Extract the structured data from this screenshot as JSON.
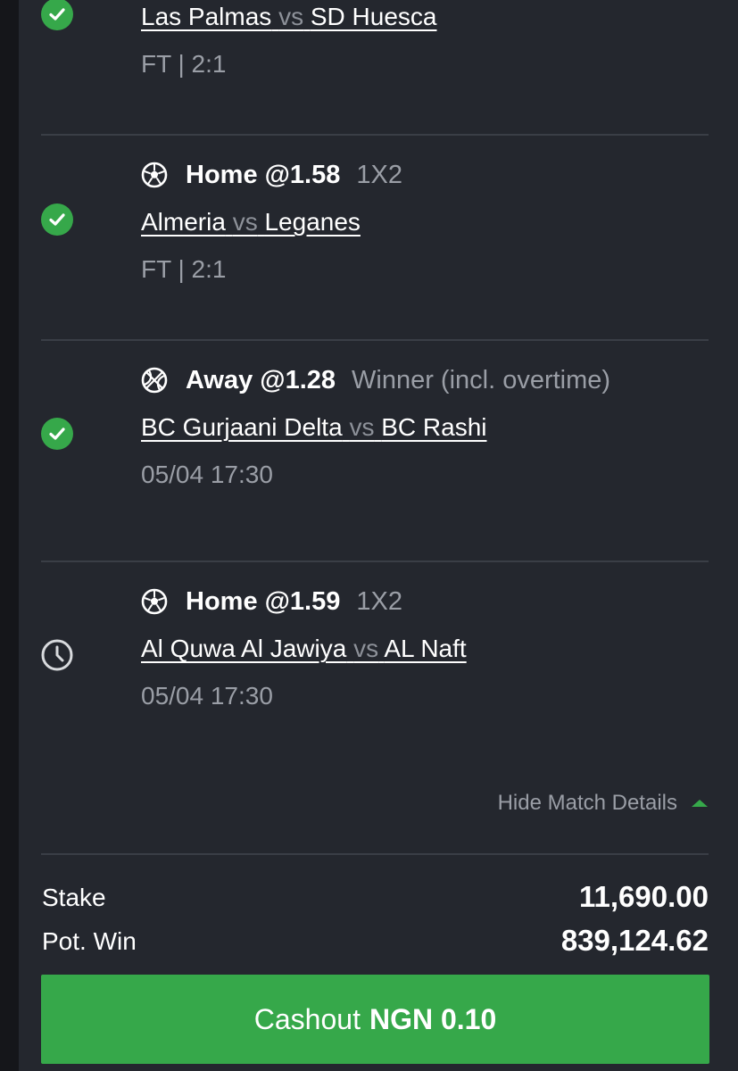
{
  "colors": {
    "page_bg": "#15161a",
    "panel_bg": "#24272e",
    "accent_green": "#36a84a",
    "muted_text": "#9a9ea6",
    "divider": "#3a3e46"
  },
  "selections": [
    {
      "status": "won",
      "status_icon": "check-circle-icon",
      "teams": {
        "home": "Las Palmas",
        "vs": "vs",
        "away": "SD Huesca"
      },
      "meta": "FT | 2:1"
    },
    {
      "status": "won",
      "status_icon": "check-circle-icon",
      "sport_icon": "football-icon",
      "pick": "Home @1.58",
      "market": "1X2",
      "teams": {
        "home": "Almeria",
        "vs": "vs",
        "away": "Leganes"
      },
      "meta": "FT | 2:1"
    },
    {
      "status": "won",
      "status_icon": "check-circle-icon",
      "sport_icon": "basketball-icon",
      "pick": "Away @1.28",
      "market": "Winner (incl. overtime)",
      "teams": {
        "home": "BC Gurjaani Delta",
        "vs": "vs",
        "away": "BC Rashi"
      },
      "meta": "05/04 17:30"
    },
    {
      "status": "pending",
      "status_icon": "clock-icon",
      "sport_icon": "football-icon",
      "pick": "Home @1.59",
      "market": "1X2",
      "teams": {
        "home": "Al Quwa Al Jawiya",
        "vs": "vs",
        "away": "AL Naft"
      },
      "meta": "05/04 17:30"
    }
  ],
  "toggle": {
    "label": "Hide Match Details",
    "icon": "caret-up-icon"
  },
  "summary": {
    "stake_label": "Stake",
    "stake_value": "11,690.00",
    "potwin_label": "Pot. Win",
    "potwin_value": "839,124.62"
  },
  "cashout": {
    "label": "Cashout",
    "amount": "NGN 0.10"
  }
}
